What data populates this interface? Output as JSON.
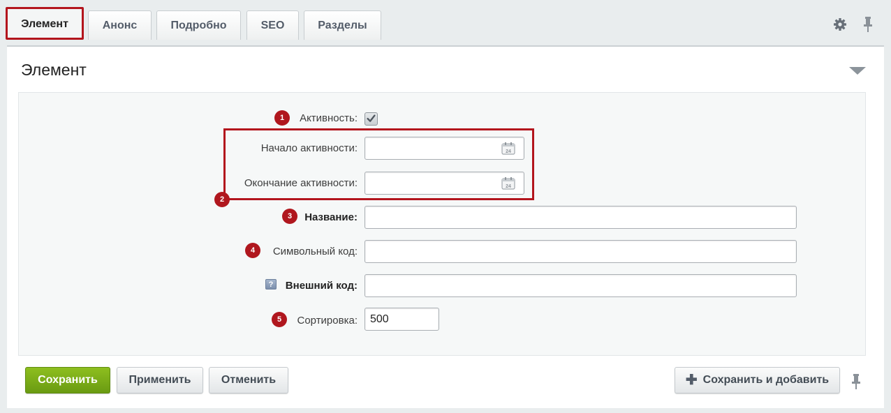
{
  "tabs": [
    {
      "label": "Элемент",
      "active": true
    },
    {
      "label": "Анонс"
    },
    {
      "label": "Подробно"
    },
    {
      "label": "SEO"
    },
    {
      "label": "Разделы"
    }
  ],
  "panel": {
    "title": "Элемент"
  },
  "form": {
    "active": {
      "badge": "1",
      "label": "Активность:",
      "checked": true
    },
    "active_from": {
      "label": "Начало активности:",
      "value": ""
    },
    "active_to": {
      "label": "Окончание активности:",
      "value": ""
    },
    "dates_badge": "2",
    "name": {
      "badge": "3",
      "label": "Название:",
      "value": ""
    },
    "code": {
      "badge": "4",
      "label": "Символьный код:",
      "value": ""
    },
    "external_code": {
      "help_mark": "?",
      "label": "Внешний код:",
      "value": ""
    },
    "sort": {
      "badge": "5",
      "label": "Сортировка:",
      "value": "500"
    },
    "calendar_day": "24"
  },
  "buttons": {
    "save": "Сохранить",
    "apply": "Применить",
    "cancel": "Отменить",
    "save_and_add": "Сохранить и добавить"
  },
  "colors": {
    "highlight": "#b3151d",
    "save_button": "#7aad18",
    "badge": "#b0171e"
  },
  "icons": [
    "gear-icon",
    "pin-icon",
    "collapse-triangle-icon",
    "calendar-icon",
    "help-icon",
    "plus-icon",
    "checkmark-icon"
  ]
}
